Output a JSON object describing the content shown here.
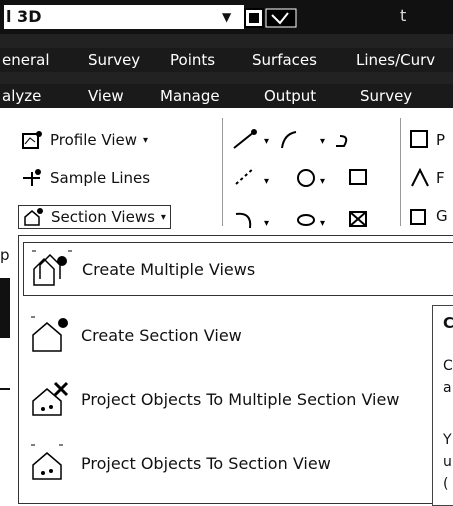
{
  "title_bar": {
    "app_title": "l 3D",
    "right_text": "t"
  },
  "menu_row_1": [
    "eneral",
    "Survey",
    "Points",
    "Surfaces",
    "Lines/Curv"
  ],
  "menu_row_2": [
    "alyze",
    "View",
    "Manage",
    "Output",
    "Survey"
  ],
  "ribbon": {
    "profile_view": "Profile View",
    "sample_lines": "Sample Lines",
    "section_views": "Section Views",
    "right_col": [
      "P",
      "F",
      "G"
    ],
    "left_fragment": "p"
  },
  "dropdown": {
    "items": [
      {
        "label": "Create Multiple Views",
        "icon": "section-multiple-views-icon"
      },
      {
        "label": "Create Section View",
        "icon": "section-view-icon"
      },
      {
        "label": "Project Objects To Multiple Section View",
        "icon": "project-multiple-icon"
      },
      {
        "label": "Project Objects To Section View",
        "icon": "project-single-icon"
      }
    ]
  },
  "tooltip": {
    "lines": [
      "C",
      "C",
      "a",
      "Y",
      "u",
      "("
    ]
  }
}
